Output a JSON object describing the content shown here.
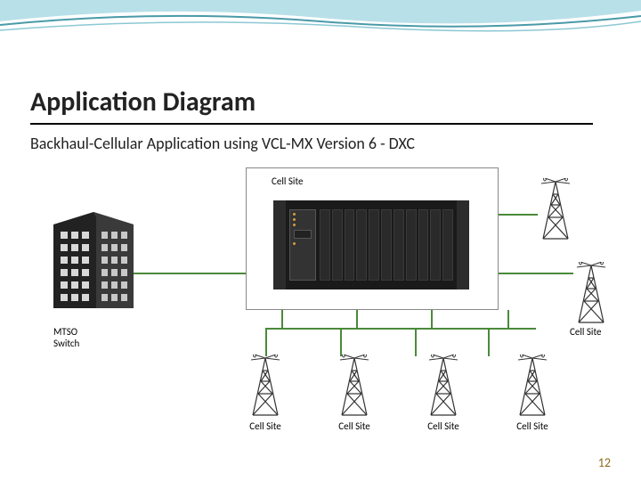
{
  "title": "Application Diagram",
  "subtitle": "Backhaul-Cellular Application using VCL-MX Version 6 - DXC",
  "device_label": "Cell Site",
  "mtso_label_line1": "MTSO",
  "mtso_label_line2": "Switch",
  "towers": {
    "top": "",
    "right_label": "Cell Site",
    "bottom": [
      "Cell Site",
      "Cell Site",
      "Cell Site",
      "Cell Site"
    ]
  },
  "page_number": "12",
  "colors": {
    "connector": "#4a8a3a",
    "wave_light": "#b8e0e8",
    "wave_dark": "#4a9aa8",
    "page_num": "#8a6a1f"
  }
}
